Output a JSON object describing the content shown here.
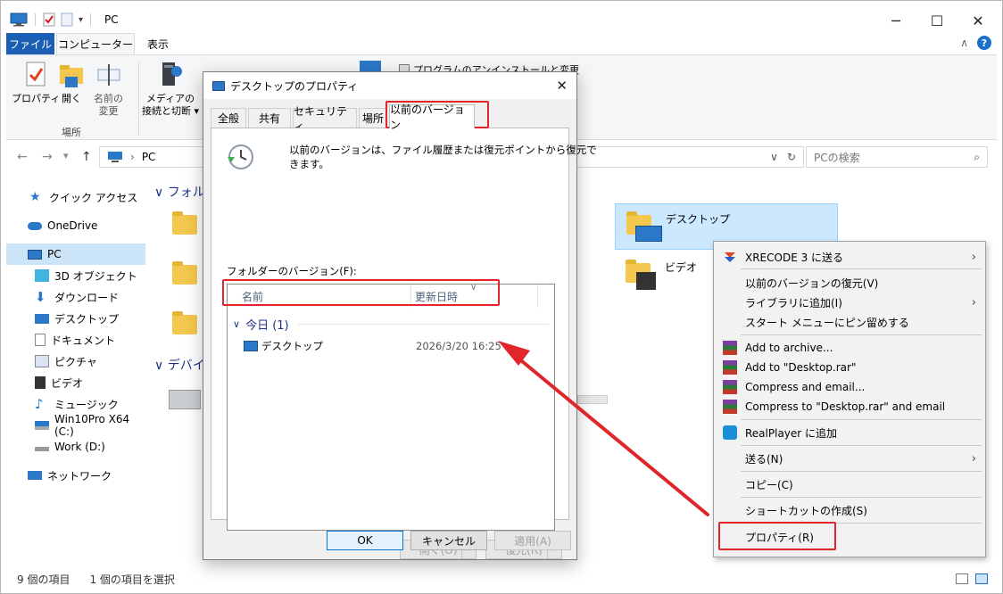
{
  "window": {
    "title": "PC",
    "minimize": "─",
    "maximize": "☐",
    "close": "✕"
  },
  "ribbon": {
    "tabs": [
      "ファイル",
      "コンピューター",
      "表示"
    ],
    "items": {
      "properties": "プロパティ",
      "open": "開く",
      "rename_line1": "名前の",
      "rename_line2": "変更",
      "media_line1": "メディアの",
      "media_line2": "接続と切断"
    },
    "group_location": "場所",
    "partial_uninstall": "プログラムのアンインストールと変更"
  },
  "address": {
    "path": "PC",
    "search_placeholder": "PCの検索"
  },
  "nav": [
    "クイック アクセス",
    "OneDrive",
    "PC",
    "3D オブジェクト",
    "ダウンロード",
    "デスクトップ",
    "ドキュメント",
    "ピクチャ",
    "ビデオ",
    "ミュージック",
    "Win10Pro X64 (C:)",
    "Work (D:)",
    "ネットワーク"
  ],
  "main": {
    "group_folders": "フォルダー",
    "group_devices": "デバイス",
    "selected_folder": "デスクトップ",
    "video_folder": "ビデオ"
  },
  "status": {
    "items": "9 個の項目",
    "selected": "1 個の項目を選択"
  },
  "dialog": {
    "title": "デスクトップのプロパティ",
    "tabs": [
      "全般",
      "共有",
      "セキュリティ",
      "場所",
      "以前のバージョン"
    ],
    "info_line1": "以前のバージョンは、ファイル履歴または復元ポイントから復元で",
    "info_line2": "きます。",
    "list_label": "フォルダーのバージョン(F):",
    "col_name": "名前",
    "col_modified": "更新日時",
    "group_today": "今日 (1)",
    "row_name": "デスクトップ",
    "row_date": "2026/3/20 16:25",
    "btn_open": "開く(O)",
    "btn_restore": "復元(R)",
    "btn_ok": "OK",
    "btn_cancel": "キャンセル",
    "btn_apply": "適用(A)"
  },
  "context_menu": {
    "items": [
      "XRECODE 3 に送る",
      "以前のバージョンの復元(V)",
      "ライブラリに追加(I)",
      "スタート メニューにピン留めする",
      "Add to archive...",
      "Add to \"Desktop.rar\"",
      "Compress and email...",
      "Compress to \"Desktop.rar\" and email",
      "RealPlayer に追加",
      "送る(N)",
      "コピー(C)",
      "ショートカットの作成(S)",
      "プロパティ(R)"
    ]
  },
  "colors": {
    "accent": "#1a5fb4",
    "highlight": "#e0262b",
    "selection": "#cce4f7"
  }
}
